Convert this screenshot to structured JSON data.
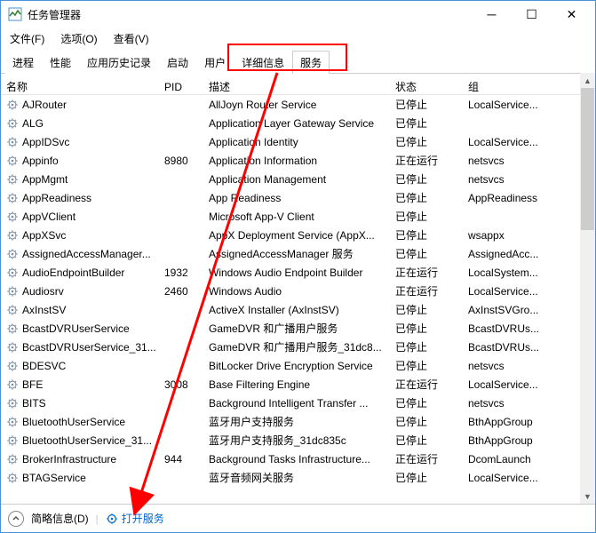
{
  "window": {
    "title": "任务管理器"
  },
  "menu": {
    "file": "文件(F)",
    "options": "选项(O)",
    "view": "查看(V)"
  },
  "tabs": {
    "processes": "进程",
    "performance": "性能",
    "app_history": "应用历史记录",
    "startup": "启动",
    "users": "用户",
    "details": "详细信息",
    "services": "服务"
  },
  "columns": {
    "name": "名称",
    "pid": "PID",
    "desc": "描述",
    "status": "状态",
    "group": "组"
  },
  "footer": {
    "brief": "简略信息(D)",
    "open_services": "打开服务"
  },
  "services": [
    {
      "name": "AJRouter",
      "pid": "",
      "desc": "AllJoyn Router Service",
      "status": "已停止",
      "group": "LocalService..."
    },
    {
      "name": "ALG",
      "pid": "",
      "desc": "Application Layer Gateway Service",
      "status": "已停止",
      "group": ""
    },
    {
      "name": "AppIDSvc",
      "pid": "",
      "desc": "Application Identity",
      "status": "已停止",
      "group": "LocalService..."
    },
    {
      "name": "Appinfo",
      "pid": "8980",
      "desc": "Application Information",
      "status": "正在运行",
      "group": "netsvcs"
    },
    {
      "name": "AppMgmt",
      "pid": "",
      "desc": "Application Management",
      "status": "已停止",
      "group": "netsvcs"
    },
    {
      "name": "AppReadiness",
      "pid": "",
      "desc": "App Readiness",
      "status": "已停止",
      "group": "AppReadiness"
    },
    {
      "name": "AppVClient",
      "pid": "",
      "desc": "Microsoft App-V Client",
      "status": "已停止",
      "group": ""
    },
    {
      "name": "AppXSvc",
      "pid": "",
      "desc": "AppX Deployment Service (AppX...",
      "status": "已停止",
      "group": "wsappx"
    },
    {
      "name": "AssignedAccessManager...",
      "pid": "",
      "desc": "AssignedAccessManager 服务",
      "status": "已停止",
      "group": "AssignedAcc..."
    },
    {
      "name": "AudioEndpointBuilder",
      "pid": "1932",
      "desc": "Windows Audio Endpoint Builder",
      "status": "正在运行",
      "group": "LocalSystem..."
    },
    {
      "name": "Audiosrv",
      "pid": "2460",
      "desc": "Windows Audio",
      "status": "正在运行",
      "group": "LocalService..."
    },
    {
      "name": "AxInstSV",
      "pid": "",
      "desc": "ActiveX Installer (AxInstSV)",
      "status": "已停止",
      "group": "AxInstSVGro..."
    },
    {
      "name": "BcastDVRUserService",
      "pid": "",
      "desc": "GameDVR 和广播用户服务",
      "status": "已停止",
      "group": "BcastDVRUs..."
    },
    {
      "name": "BcastDVRUserService_31...",
      "pid": "",
      "desc": "GameDVR 和广播用户服务_31dc8...",
      "status": "已停止",
      "group": "BcastDVRUs..."
    },
    {
      "name": "BDESVC",
      "pid": "",
      "desc": "BitLocker Drive Encryption Service",
      "status": "已停止",
      "group": "netsvcs"
    },
    {
      "name": "BFE",
      "pid": "3008",
      "desc": "Base Filtering Engine",
      "status": "正在运行",
      "group": "LocalService..."
    },
    {
      "name": "BITS",
      "pid": "",
      "desc": "Background Intelligent Transfer ...",
      "status": "已停止",
      "group": "netsvcs"
    },
    {
      "name": "BluetoothUserService",
      "pid": "",
      "desc": "蓝牙用户支持服务",
      "status": "已停止",
      "group": "BthAppGroup"
    },
    {
      "name": "BluetoothUserService_31...",
      "pid": "",
      "desc": "蓝牙用户支持服务_31dc835c",
      "status": "已停止",
      "group": "BthAppGroup"
    },
    {
      "name": "BrokerInfrastructure",
      "pid": "944",
      "desc": "Background Tasks Infrastructure...",
      "status": "正在运行",
      "group": "DcomLaunch"
    },
    {
      "name": "BTAGService",
      "pid": "",
      "desc": "蓝牙音频网关服务",
      "status": "已停止",
      "group": "LocalService..."
    }
  ]
}
